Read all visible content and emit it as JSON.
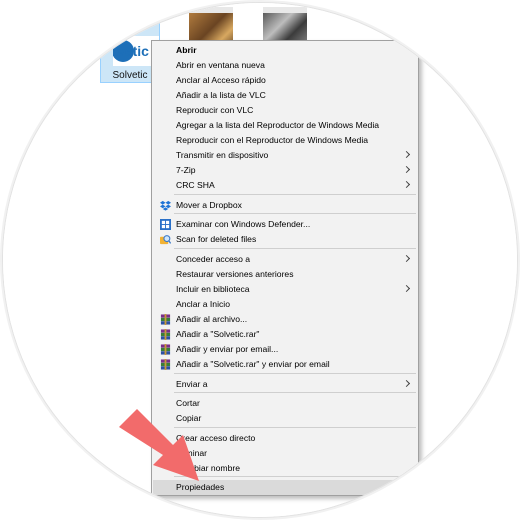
{
  "desktop": {
    "folder_label": "Solvetic",
    "folder_logo_text": "vetic"
  },
  "context_menu": {
    "items": [
      {
        "label": "Abrir",
        "bold": true
      },
      {
        "label": "Abrir en ventana nueva"
      },
      {
        "label": "Anclar al Acceso rápido"
      },
      {
        "label": "Añadir a la lista de VLC"
      },
      {
        "label": "Reproducir con VLC"
      },
      {
        "label": "Agregar a la lista del Reproductor de Windows Media"
      },
      {
        "label": "Reproducir con el Reproductor de Windows Media"
      },
      {
        "label": "Transmitir en dispositivo",
        "submenu": true
      },
      {
        "label": "7-Zip",
        "submenu": true
      },
      {
        "label": "CRC SHA",
        "submenu": true
      },
      {
        "label": "Mover a Dropbox",
        "icon": "dropbox-icon"
      },
      {
        "label": "Examinar con Windows Defender...",
        "icon": "windows-defender-icon"
      },
      {
        "label": "Scan for deleted files",
        "icon": "recovery-scan-icon"
      },
      {
        "label": "Conceder acceso a",
        "submenu": true
      },
      {
        "label": "Restaurar versiones anteriores"
      },
      {
        "label": "Incluir en biblioteca",
        "submenu": true
      },
      {
        "label": "Anclar a Inicio"
      },
      {
        "label": "Añadir al archivo...",
        "icon": "winrar-icon"
      },
      {
        "label": "Añadir a \"Solvetic.rar\"",
        "icon": "winrar-icon"
      },
      {
        "label": "Añadir y enviar por email...",
        "icon": "winrar-icon"
      },
      {
        "label": "Añadir a \"Solvetic.rar\" y enviar por email",
        "icon": "winrar-icon"
      },
      {
        "label": "Enviar a",
        "submenu": true
      },
      {
        "label": "Cortar"
      },
      {
        "label": "Copiar"
      },
      {
        "label": "Crear acceso directo"
      },
      {
        "label": "Eliminar"
      },
      {
        "label": "Cambiar nombre"
      },
      {
        "label": "Propiedades",
        "highlighted": true
      }
    ]
  },
  "colors": {
    "menu_background": "#f2f2f2",
    "highlight": "#dadada",
    "selection": "#cde6f7",
    "pointer_arrow": "#f26b6b"
  }
}
